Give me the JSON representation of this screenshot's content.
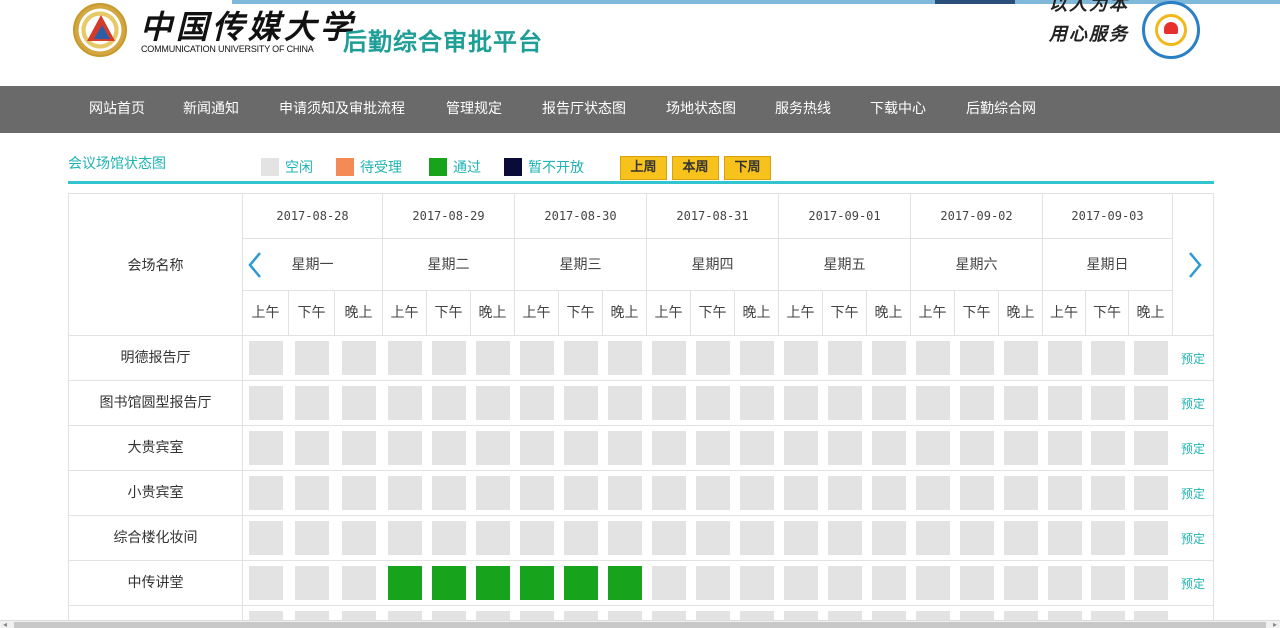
{
  "header": {
    "university_cn": "中国传媒大学",
    "university_en": "COMMUNICATION UNIVERSITY OF CHINA",
    "system_title": "后勤综合审批平台",
    "slogan_line1": "以人为本",
    "slogan_line2": "用心服务"
  },
  "nav": {
    "items": [
      {
        "label": "网站首页"
      },
      {
        "label": "新闻通知"
      },
      {
        "label": "申请须知及审批流程"
      },
      {
        "label": "管理规定"
      },
      {
        "label": "报告厅状态图"
      },
      {
        "label": "场地状态图"
      },
      {
        "label": "服务热线"
      },
      {
        "label": "下载中心"
      },
      {
        "label": "后勤综合网"
      }
    ]
  },
  "legend": {
    "title": "会议场馆状态图",
    "items": [
      {
        "label": "空闲",
        "color": "#e3e3e3"
      },
      {
        "label": "待受理",
        "color": "#f48a55"
      },
      {
        "label": "通过",
        "color": "#17a41c"
      },
      {
        "label": "暂不开放",
        "color": "#0b0b3a"
      }
    ],
    "buttons": {
      "prev": "上周",
      "current": "本周",
      "next": "下周"
    }
  },
  "table": {
    "name_header": "会场名称",
    "days": [
      {
        "date": "2017-08-28",
        "weekday": "星期一"
      },
      {
        "date": "2017-08-29",
        "weekday": "星期二"
      },
      {
        "date": "2017-08-30",
        "weekday": "星期三"
      },
      {
        "date": "2017-08-31",
        "weekday": "星期四"
      },
      {
        "date": "2017-09-01",
        "weekday": "星期五"
      },
      {
        "date": "2017-09-02",
        "weekday": "星期六"
      },
      {
        "date": "2017-09-03",
        "weekday": "星期日"
      }
    ],
    "slots": [
      "上午",
      "下午",
      "晚上"
    ],
    "book_label": "预定",
    "rows": [
      {
        "name": "明德报告厅",
        "status": [
          "free",
          "free",
          "free",
          "free",
          "free",
          "free",
          "free",
          "free",
          "free",
          "free",
          "free",
          "free",
          "free",
          "free",
          "free",
          "free",
          "free",
          "free",
          "free",
          "free",
          "free"
        ]
      },
      {
        "name": "图书馆圆型报告厅",
        "status": [
          "free",
          "free",
          "free",
          "free",
          "free",
          "free",
          "free",
          "free",
          "free",
          "free",
          "free",
          "free",
          "free",
          "free",
          "free",
          "free",
          "free",
          "free",
          "free",
          "free",
          "free"
        ]
      },
      {
        "name": "大贵宾室",
        "status": [
          "free",
          "free",
          "free",
          "free",
          "free",
          "free",
          "free",
          "free",
          "free",
          "free",
          "free",
          "free",
          "free",
          "free",
          "free",
          "free",
          "free",
          "free",
          "free",
          "free",
          "free"
        ]
      },
      {
        "name": "小贵宾室",
        "status": [
          "free",
          "free",
          "free",
          "free",
          "free",
          "free",
          "free",
          "free",
          "free",
          "free",
          "free",
          "free",
          "free",
          "free",
          "free",
          "free",
          "free",
          "free",
          "free",
          "free",
          "free"
        ]
      },
      {
        "name": "综合楼化妆间",
        "status": [
          "free",
          "free",
          "free",
          "free",
          "free",
          "free",
          "free",
          "free",
          "free",
          "free",
          "free",
          "free",
          "free",
          "free",
          "free",
          "free",
          "free",
          "free",
          "free",
          "free",
          "free"
        ]
      },
      {
        "name": "中传讲堂",
        "status": [
          "free",
          "free",
          "free",
          "pass",
          "pass",
          "pass",
          "pass",
          "pass",
          "pass",
          "free",
          "free",
          "free",
          "free",
          "free",
          "free",
          "free",
          "free",
          "free",
          "free",
          "free",
          "free"
        ]
      },
      {
        "name": "",
        "status": [
          "free",
          "free",
          "free",
          "free",
          "free",
          "free",
          "free",
          "free",
          "free",
          "free",
          "free",
          "free",
          "free",
          "free",
          "free",
          "free",
          "free",
          "free",
          "free",
          "free",
          "free"
        ]
      }
    ]
  }
}
